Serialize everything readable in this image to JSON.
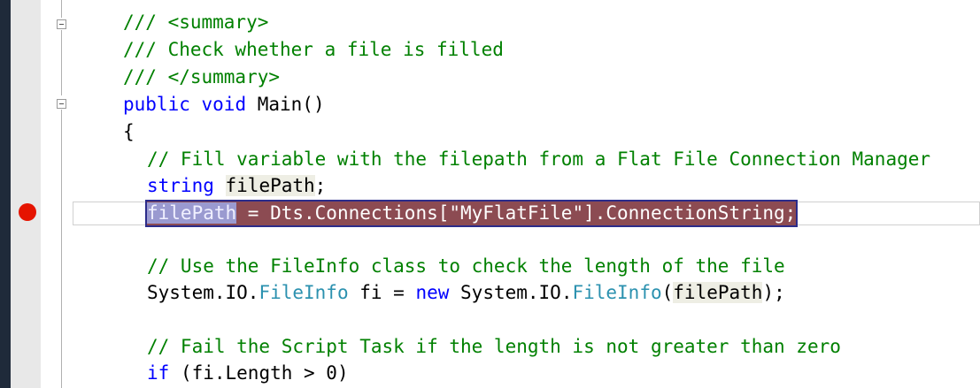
{
  "editor": {
    "lines": [
      {
        "id": "summary-open",
        "parts": [
          {
            "t": "/// <summary>",
            "c": "comment"
          }
        ]
      },
      {
        "id": "summary-text",
        "parts": [
          {
            "t": "/// Check whether a file is filled",
            "c": "comment"
          }
        ]
      },
      {
        "id": "summary-close",
        "parts": [
          {
            "t": "/// </summary>",
            "c": "comment"
          }
        ]
      },
      {
        "id": "method-signature",
        "parts": [
          {
            "t": "public",
            "c": "keyword"
          },
          {
            "t": " "
          },
          {
            "t": "void",
            "c": "keyword"
          },
          {
            "t": " Main()"
          }
        ]
      },
      {
        "id": "open-brace",
        "parts": [
          {
            "t": "{"
          }
        ]
      },
      {
        "id": "comment-fill",
        "parts": [
          {
            "t": "// Fill variable with the filepath from a Flat File Connection Manager",
            "c": "comment"
          }
        ]
      },
      {
        "id": "declare-filepath",
        "parts": [
          {
            "t": "string",
            "c": "keyword"
          },
          {
            "t": " "
          },
          {
            "t": "filePath",
            "c": "ref"
          },
          {
            "t": ";"
          }
        ]
      },
      {
        "id": "assign-filepath",
        "selected": true,
        "parts": [
          {
            "t": "filePath",
            "c": "selfirst"
          },
          {
            "t": " = Dts.Connections["
          },
          {
            "t": "\"MyFlatFile\"",
            "c": "stringsel"
          },
          {
            "t": "].ConnectionString;"
          }
        ]
      },
      {
        "id": "blank-1",
        "parts": [
          {
            "t": ""
          }
        ]
      },
      {
        "id": "comment-fileinfo",
        "parts": [
          {
            "t": "// Use the FileInfo class to check the length of the file",
            "c": "comment"
          }
        ]
      },
      {
        "id": "fileinfo-decl",
        "parts": [
          {
            "t": "System.IO."
          },
          {
            "t": "FileInfo",
            "c": "type"
          },
          {
            "t": " fi = "
          },
          {
            "t": "new",
            "c": "keyword"
          },
          {
            "t": " System.IO."
          },
          {
            "t": "FileInfo",
            "c": "type"
          },
          {
            "t": "("
          },
          {
            "t": "filePath",
            "c": "ref"
          },
          {
            "t": ");"
          }
        ]
      },
      {
        "id": "blank-2",
        "parts": [
          {
            "t": ""
          }
        ]
      },
      {
        "id": "comment-fail",
        "parts": [
          {
            "t": "// Fail the Script Task if the length is not greater than zero",
            "c": "comment"
          }
        ]
      },
      {
        "id": "if-length",
        "parts": [
          {
            "t": "if",
            "c": "keyword"
          },
          {
            "t": " (fi.Length > 0)"
          }
        ]
      }
    ],
    "breakpoint_line": "assign-filepath",
    "colors": {
      "comment": "#008000",
      "keyword": "#0000ff",
      "type": "#2b91af",
      "breakpoint": "#e51400",
      "selection": "#8c4b52",
      "selection_border": "#2c2c8a"
    }
  }
}
